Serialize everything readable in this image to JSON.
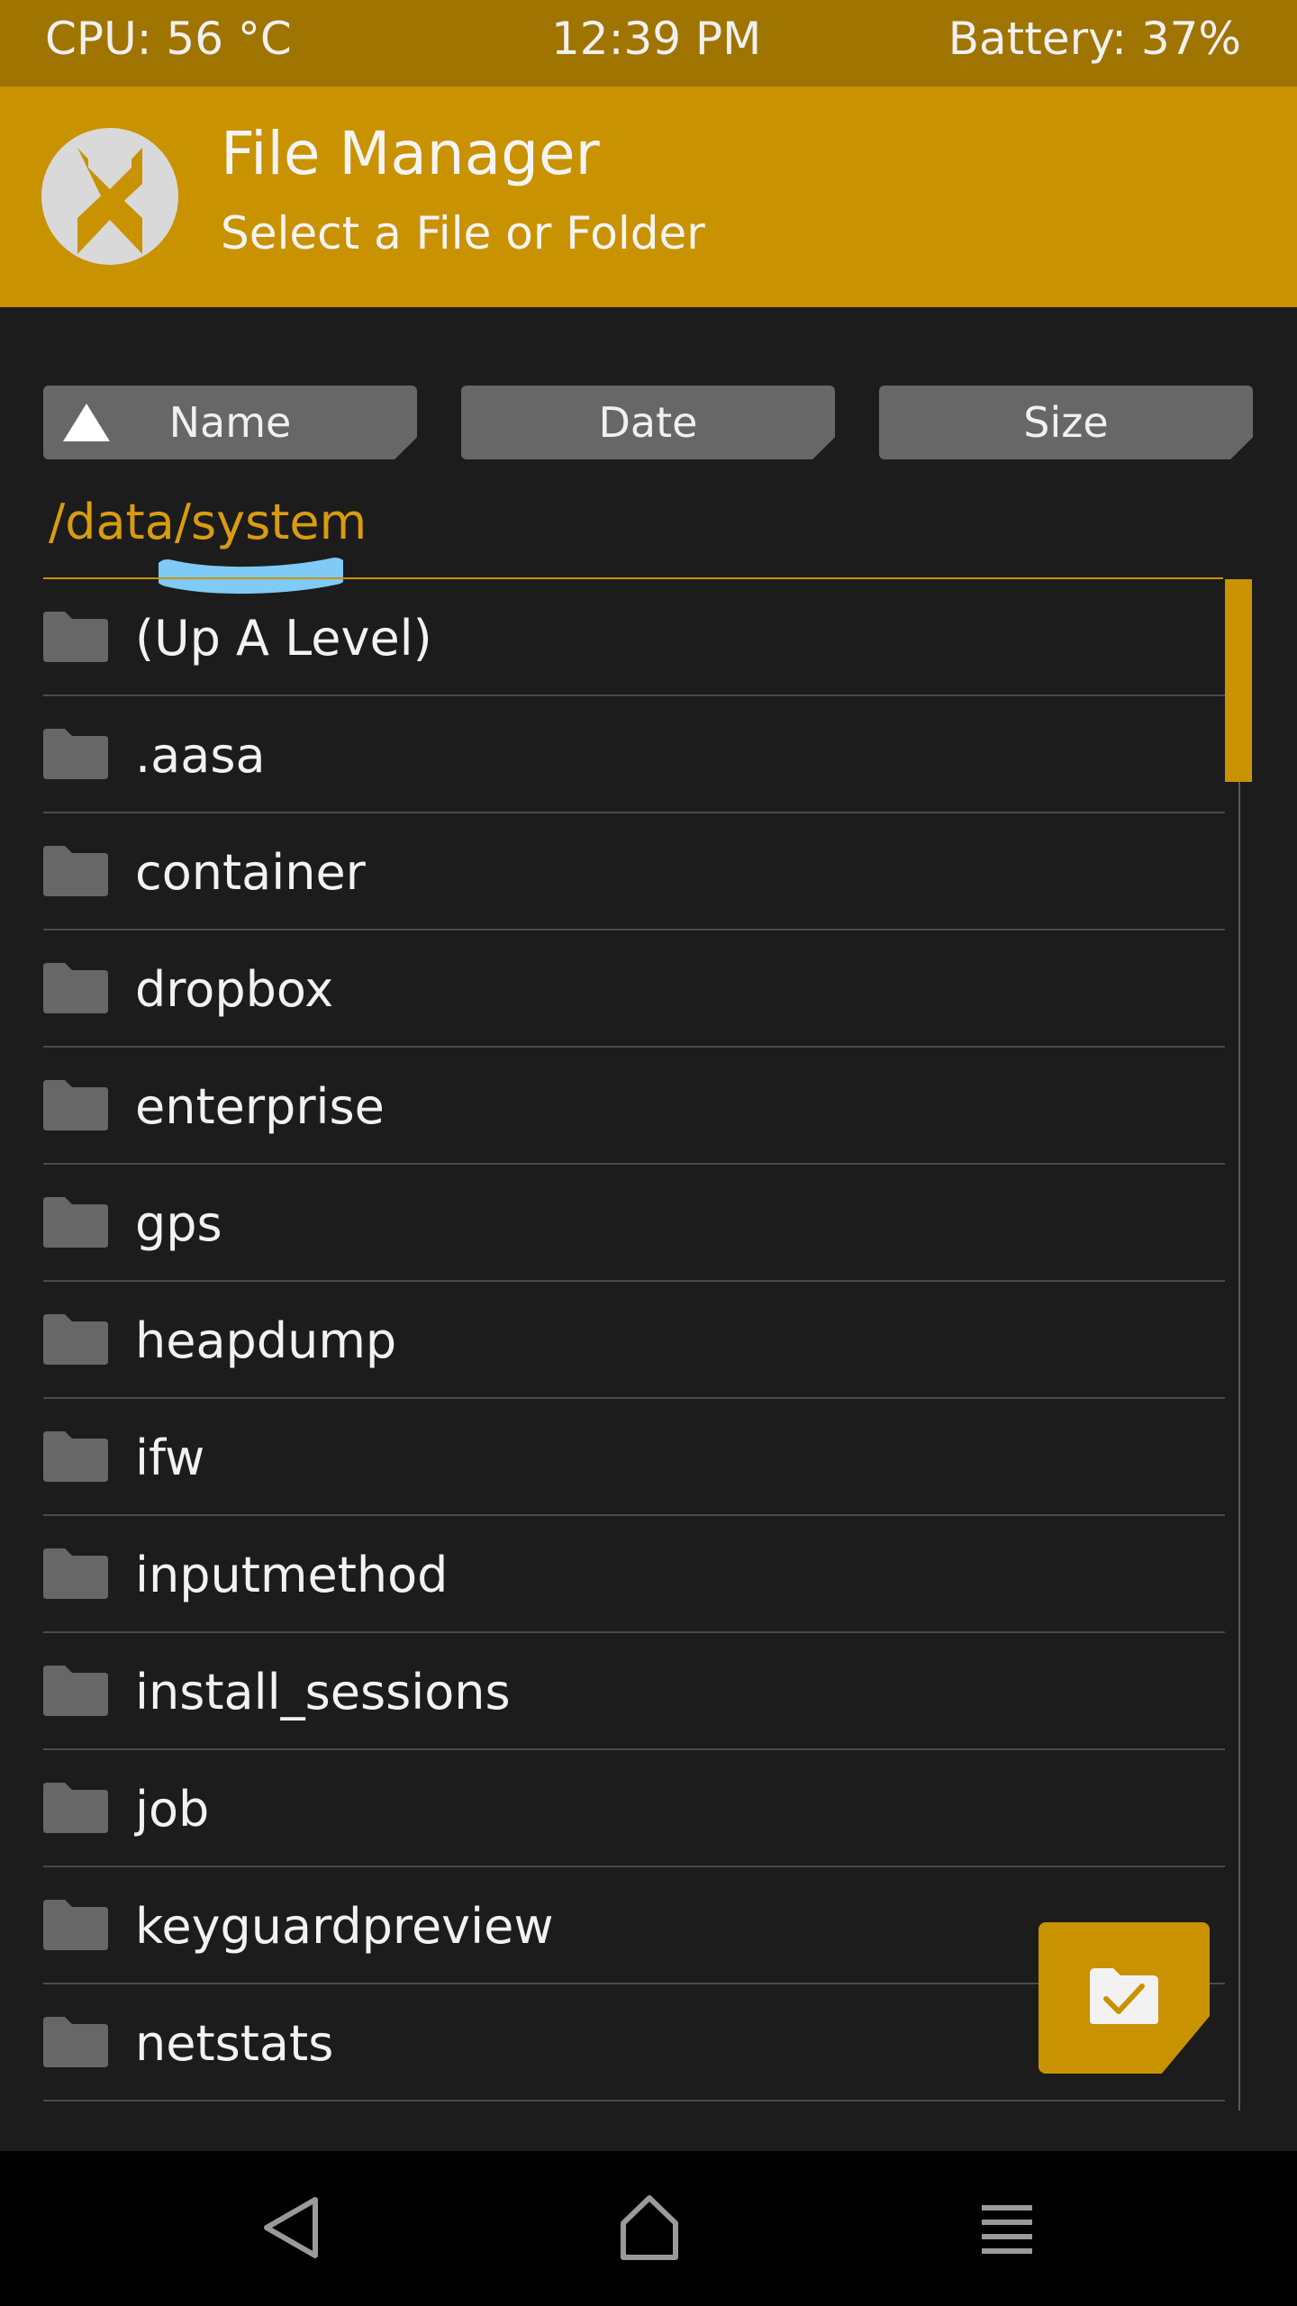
{
  "status_bar": {
    "cpu": "CPU: 56 °C",
    "time": "12:39 PM",
    "battery": "Battery: 37%"
  },
  "header": {
    "title": "File Manager",
    "subtitle": "Select a File or Folder"
  },
  "sort_buttons": {
    "name": "Name",
    "date": "Date",
    "size": "Size"
  },
  "current_path": "/data/system",
  "files": [
    {
      "name": "(Up A Level)",
      "icon": "folder-icon"
    },
    {
      "name": ".aasa",
      "icon": "folder-icon"
    },
    {
      "name": "container",
      "icon": "folder-icon"
    },
    {
      "name": "dropbox",
      "icon": "folder-icon"
    },
    {
      "name": "enterprise",
      "icon": "folder-icon"
    },
    {
      "name": "gps",
      "icon": "folder-icon"
    },
    {
      "name": "heapdump",
      "icon": "folder-icon"
    },
    {
      "name": "ifw",
      "icon": "folder-icon"
    },
    {
      "name": "inputmethod",
      "icon": "folder-icon"
    },
    {
      "name": "install_sessions",
      "icon": "folder-icon"
    },
    {
      "name": "job",
      "icon": "folder-icon"
    },
    {
      "name": "keyguardpreview",
      "icon": "folder-icon"
    },
    {
      "name": "netstats",
      "icon": "folder-icon"
    }
  ],
  "colors": {
    "status_bar": "#a07400",
    "accent": "#c99200",
    "path_text": "#d99c10",
    "background": "#1c1c1c",
    "button": "#676767",
    "scribble": "#7fcaf6"
  },
  "icons": {
    "logo": "twrp-logo-icon",
    "sort_direction": "triangle-up-icon",
    "select_folder": "folder-check-icon",
    "nav_back": "back-triangle-icon",
    "nav_home": "home-icon",
    "nav_menu": "menu-icon"
  }
}
